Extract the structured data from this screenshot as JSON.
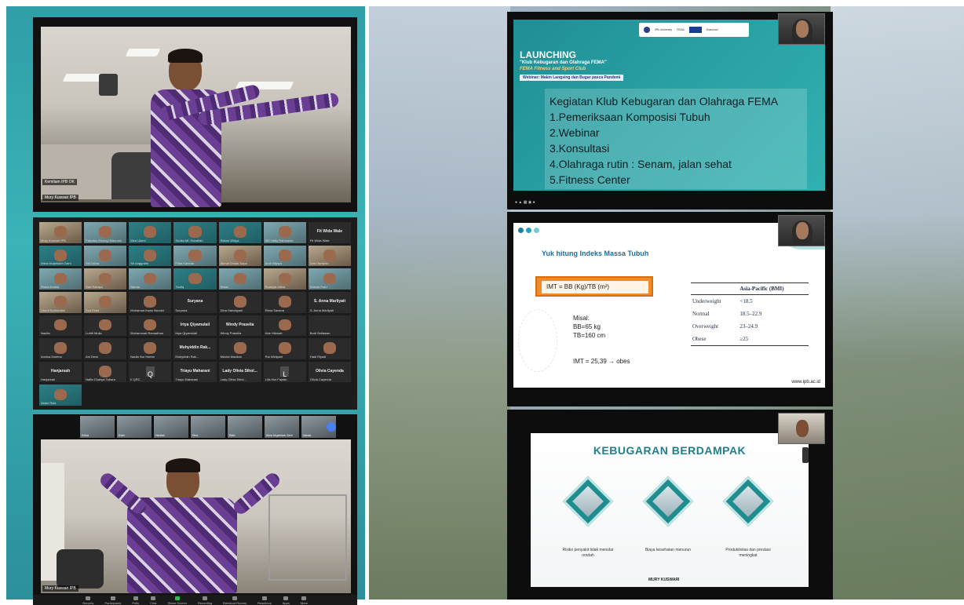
{
  "left": {
    "speaker_top": {
      "name_tag": "Mury Kuswari IPB",
      "side_tag": "Kemtlam IPB OK"
    },
    "gallery": {
      "tiles": [
        {
          "name": "Mury Kuswari IPB",
          "type": "video2"
        },
        {
          "name": "Fakultas Ekologi Manusia",
          "type": "video"
        },
        {
          "name": "Mira Utami",
          "type": "video3"
        },
        {
          "name": "Sunita Mf. Hanafiah",
          "type": "video3"
        },
        {
          "name": "Rahmi Widya",
          "type": "video3"
        },
        {
          "name": "MC Hafiy Rahmania",
          "type": "video"
        },
        {
          "name": "Fit Wida Wale",
          "type": "text",
          "big": "Fit Wida Wale"
        },
        {
          "name": "Atina Mujahidah Zaini",
          "type": "video3"
        },
        {
          "name": "Siti Zahra",
          "type": "video"
        },
        {
          "name": "Sri Anggraini",
          "type": "video3"
        },
        {
          "name": "Fitria Karinda",
          "type": "video"
        },
        {
          "name": "Akmal Dinata Sapa",
          "type": "video2"
        },
        {
          "name": "Andi Wijaya",
          "type": "video"
        },
        {
          "name": "Deri Hartanto",
          "type": "video2"
        },
        {
          "name": "Riska Amalia",
          "type": "video"
        },
        {
          "name": "Sari Rahayu",
          "type": "video2"
        },
        {
          "name": "Nanda",
          "type": "video"
        },
        {
          "name": "Taufiq",
          "type": "video3"
        },
        {
          "name": "Reski",
          "type": "video"
        },
        {
          "name": "Rumiyat Alfina",
          "type": "video2"
        },
        {
          "name": "Adinda Putri",
          "type": "video"
        },
        {
          "name": "Utami Nurhanifah",
          "type": "video2"
        },
        {
          "name": "Eva Febri",
          "type": "video2"
        },
        {
          "name": "Muhamad Irwan Nuraini",
          "type": "person"
        },
        {
          "name": "Suryana",
          "type": "text",
          "big": "Suryana"
        },
        {
          "name": "Dina Handayani",
          "type": "person"
        },
        {
          "name": "Rena Savana",
          "type": "person"
        },
        {
          "name": "S. Anna Marliyati",
          "type": "text",
          "big": "S. Anna Marliyati"
        },
        {
          "name": "Naufia",
          "type": "person"
        },
        {
          "name": "Luthfi Mulia",
          "type": "person"
        },
        {
          "name": "Muhammad Ramadhan",
          "type": "person"
        },
        {
          "name": "Irtya Qiyamulail",
          "type": "text",
          "big": "Irtya Qiyamulail"
        },
        {
          "name": "Windy Praselia",
          "type": "text",
          "big": "Windy Praselia"
        },
        {
          "name": "Ade Hikmah",
          "type": "person"
        },
        {
          "name": "Budi Setiawan",
          "type": "blank"
        },
        {
          "name": "Annisa Dwirina",
          "type": "person"
        },
        {
          "name": "Ani Dewi",
          "type": "person"
        },
        {
          "name": "Nadia Nur Haerin",
          "type": "person"
        },
        {
          "name": "Muhyiddin Rak...",
          "type": "text",
          "big": "Muhyiddin Rak..."
        },
        {
          "name": "Meutia Maulida",
          "type": "person"
        },
        {
          "name": "Rai Widiyani",
          "type": "person"
        },
        {
          "name": "Hadi Riyadi",
          "type": "person"
        },
        {
          "name": "Hanjarsah",
          "type": "text",
          "big": "Hanjarsah"
        },
        {
          "name": "Naffa Chahya Tobara",
          "type": "person"
        },
        {
          "name": "II QRC",
          "type": "initial",
          "initial": "Q"
        },
        {
          "name": "Triayu Maharani",
          "type": "text",
          "big": "Triayu Maharani"
        },
        {
          "name": "Lady Olivia Sihol...",
          "type": "text",
          "big": "Lady Olivia Sihol..."
        },
        {
          "name": "Lilis Nur Fajriah",
          "type": "initial",
          "initial": "L"
        },
        {
          "name": "Olivia Cayenda",
          "type": "text",
          "big": "Olivia Cayenda"
        },
        {
          "name": "Abdul Rais",
          "type": "video3"
        }
      ]
    },
    "speaker_bottom": {
      "thumbs": [
        "Erlina",
        "Ester",
        "Hanifah",
        "Dina",
        "Ratri",
        "Atina Mujahidah Zaini",
        "Nanda"
      ],
      "name_tag": "Mury Kuswari IPB",
      "toolbar": [
        "Security",
        "Participants",
        "Polls",
        "Chat",
        "Share Screen",
        "Recording",
        "Breakout Rooms",
        "Reactions",
        "Apps",
        "More"
      ]
    }
  },
  "right": {
    "slide1": {
      "logos": [
        "IPB University",
        "FEMA",
        "Erasmus+"
      ],
      "launch": "LAUNCHING",
      "club": "\"Klub Kebugaran dan Olahraga FEMA\"",
      "club_en": "FEMA Fitness and Sport Club",
      "webinar": "Webinar: Makin Langsing dan Bugar pasca Pandemi",
      "agenda_title": "Kegiatan Klub Kebugaran dan Olahraga FEMA",
      "agenda": [
        "1.Pemeriksaan Komposisi Tubuh",
        "2.Webinar",
        "3.Konsultasi",
        "4.Olahraga rutin : Senam, jalan sehat",
        "5.Fitness Center"
      ]
    },
    "slide2": {
      "title": "Yuk hitung Indeks Massa Tubuh",
      "formula": "IMT = BB (Kg)/TB (m²)",
      "misal": [
        "Misal:",
        "BB=65 kg",
        "TB=160 cm"
      ],
      "result": "IMT = 25,39 → obes",
      "table_header": [
        "",
        "Asia-Pacific (BMI)"
      ],
      "table_rows": [
        [
          "Underweight",
          "<18.5"
        ],
        [
          "Normal",
          "18.5–22.9"
        ],
        [
          "Overweight",
          "23–24.9"
        ],
        [
          "Obese",
          "≥25"
        ]
      ],
      "footer": "www.ipb.ac.id"
    },
    "slide3": {
      "title": "KEBUGARAN BERDAMPAK",
      "items": [
        "Risiko penyakit tidak menular rendah",
        "Biaya kesehatan menurun",
        "Produktivitas dan prestasi meningkat"
      ],
      "brand": "MURY KUSWARI"
    }
  },
  "colors": {
    "teal": "#2fa3a8",
    "orange": "#f08a2a",
    "slide_title_blue": "#1f6f98"
  }
}
